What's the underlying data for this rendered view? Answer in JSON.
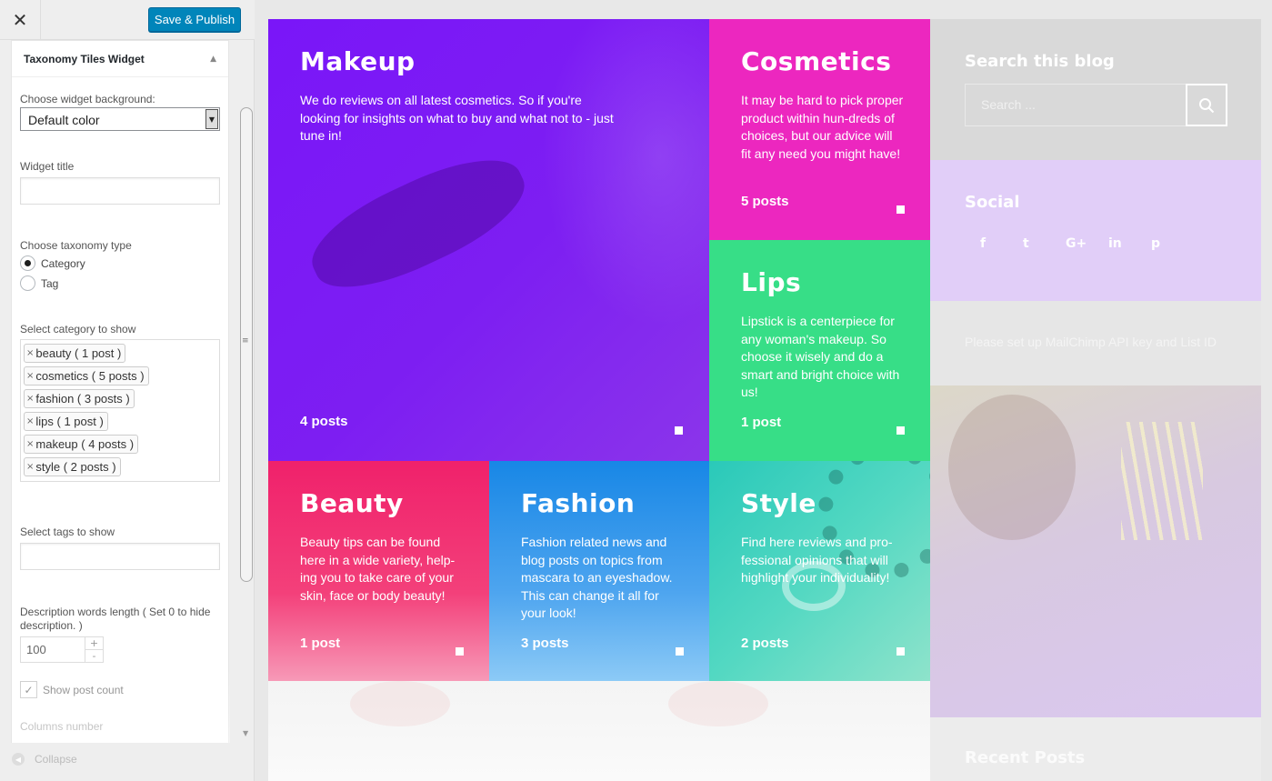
{
  "customizer": {
    "close_glyph": "✕",
    "publish_label": "Save & Publish",
    "widget": {
      "title": "Taxonomy Tiles Widget",
      "background_label": "Choose widget background:",
      "background_value": "Default color",
      "title_label": "Widget title",
      "title_value": "",
      "taxonomy_label": "Choose taxonomy type",
      "taxonomy_options": [
        "Category",
        "Tag"
      ],
      "category_label": "Select category to show",
      "categories": [
        "beauty ( 1 post )",
        "cosmetics ( 5 posts )",
        "fashion ( 3 posts )",
        "lips ( 1 post )",
        "makeup ( 4 posts )",
        "style ( 2 posts )"
      ],
      "tags_label": "Select tags to show",
      "desc_length_label": "Description words length ( Set 0 to hide description. )",
      "desc_length_value": "100",
      "show_count_label": "Show post count",
      "columns_label": "Columns number"
    },
    "collapse_label": "Collapse"
  },
  "tiles": {
    "makeup": {
      "title": "Makeup",
      "desc": "We do reviews on all latest cosmetics. So if you're looking for insights on what to buy and what not to - just tune in!",
      "count": "4 posts",
      "color": "#7b18f6"
    },
    "cosmetics": {
      "title": "Cosmetics",
      "desc": "It may be hard to pick proper product within hun-dreds of choices, but our advice will fit any need you might have!",
      "count": "5 posts",
      "color": "#ec27bf"
    },
    "lips": {
      "title": "Lips",
      "desc": "Lipstick is a centerpiece for any woman's makeup. So choose it wisely and do a smart and bright choice with us!",
      "count": "1 post",
      "color": "#37de87"
    },
    "beauty": {
      "title": "Beauty",
      "desc": "Beauty tips can be found here in a wide variety, help-ing you to take care of your skin, face or body beauty!",
      "count": "1 post",
      "color": "#f0246c"
    },
    "fashion": {
      "title": "Fashion",
      "desc": "Fashion related news and blog posts on topics from mascara to an eyeshadow. This can change it all for your look!",
      "count": "3 posts",
      "color": "#1d87e6"
    },
    "style": {
      "title": "Style",
      "desc": "Find here reviews and pro-fessional opinions that will highlight your individuality!",
      "count": "2 posts",
      "color": "#3fd4c0"
    }
  },
  "blog_sidebar": {
    "search_title": "Search this blog",
    "search_placeholder": "Search ...",
    "social_title": "Social",
    "social_icons": [
      "facebook-icon",
      "twitter-icon",
      "google-plus-icon",
      "linkedin-icon",
      "pinterest-icon"
    ],
    "social_glyphs": [
      "f",
      "t",
      "G+",
      "in",
      "p"
    ],
    "mailchimp_notice": "Please set up MailChimp API key and List ID",
    "recent_posts_title": "Recent Posts"
  }
}
